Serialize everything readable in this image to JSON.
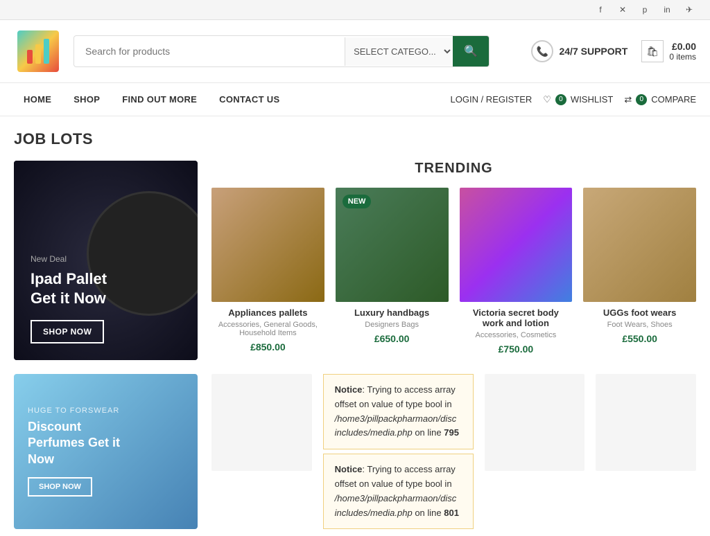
{
  "topbar": {
    "social_icons": [
      "facebook",
      "twitter",
      "pinterest",
      "linkedin",
      "telegram"
    ]
  },
  "header": {
    "logo_alt": "Store Logo",
    "search_placeholder": "Search for products",
    "category_label": "SELECT CATEGO...",
    "search_button_icon": "🔍",
    "support_label": "24/7 SUPPORT",
    "cart_price": "£0.00",
    "cart_items": "0 items"
  },
  "nav": {
    "items": [
      {
        "label": "HOME",
        "id": "home"
      },
      {
        "label": "SHOP",
        "id": "shop"
      },
      {
        "label": "FIND OUT MORE",
        "id": "find-out-more"
      },
      {
        "label": "CONTACT US",
        "id": "contact-us"
      }
    ],
    "actions": {
      "login": "LOGIN / REGISTER",
      "wishlist": "WISHLIST",
      "wishlist_count": "0",
      "compare": "COMPARE",
      "compare_count": "0"
    }
  },
  "page_title": "JOB LOTS",
  "hero": {
    "tag": "New Deal",
    "title": "Ipad Pallet\nGet it Now",
    "button": "SHOP NOW"
  },
  "trending": {
    "title": "TRENDING",
    "products": [
      {
        "name": "Appliances pallets",
        "categories": "Accessories, General Goods, Household Items",
        "price": "£850.00",
        "is_new": false,
        "img_class": "img-appliances"
      },
      {
        "name": "Luxury handbags",
        "categories": "Designers Bags",
        "price": "£650.00",
        "is_new": true,
        "img_class": "img-handbags"
      },
      {
        "name": "Victoria secret body work and lotion",
        "categories": "Accessories, Cosmetics",
        "price": "£750.00",
        "is_new": false,
        "img_class": "img-victoria"
      },
      {
        "name": "UGGs foot wears",
        "categories": "Foot Wears, Shoes",
        "price": "£550.00",
        "is_new": false,
        "img_class": "img-uggs"
      }
    ]
  },
  "banner2": {
    "tag": "HUGE TO FORSWEAR",
    "title": "Discount\nPerfumes Get it\nNow",
    "button": "SHOP NOW"
  },
  "errors": [
    {
      "label": "Notice",
      "message": "Trying to access array offset on value of type bool in",
      "path": "/home3/pillpackpharmaon/disc includes/media.php",
      "line": "795"
    },
    {
      "label": "Notice",
      "message": "Trying to access array offset on value of type bool in",
      "path": "/home3/pillpackpharmaon/disc includes/media.php",
      "line": "801"
    }
  ],
  "bottom_products": [
    {
      "img_class": "img-perfumes"
    },
    {
      "img_class": "img-cosmetics"
    },
    {
      "img_class": "img-makeup"
    }
  ]
}
